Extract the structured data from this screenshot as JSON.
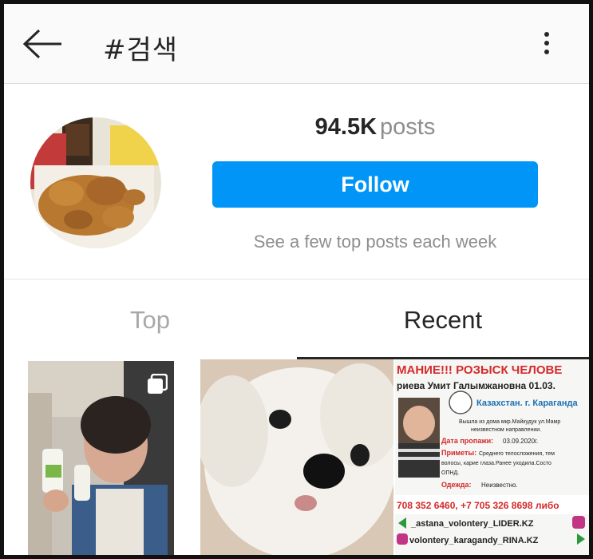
{
  "header": {
    "back_icon": "arrow-left-icon",
    "title": "#검색",
    "more_icon": "vertical-ellipsis-icon"
  },
  "profile": {
    "avatar_icon": "fried-chicken-photo",
    "posts_count": "94.5K",
    "posts_label": "posts",
    "follow_label": "Follow",
    "subtext": "See a few top posts each week",
    "accent_color": "#0095f6"
  },
  "tabs": [
    {
      "label": "Top",
      "active": false
    },
    {
      "label": "Recent",
      "active": true
    }
  ],
  "grid": {
    "items": [
      {
        "icon": "person-with-drinks-photo",
        "multi": true
      },
      {
        "icon": "white-dog-photo",
        "multi": false
      },
      {
        "icon": "missing-person-poster-photo",
        "multi": false
      }
    ],
    "poster": {
      "line1": "МАНИЕ!!! РОЗЫСК ЧЕЛОВЕ",
      "line2": "риева Умит Галымжановна 01.03.",
      "line3": "Казахстан. г. Караганда",
      "line4": "Вышла из дома мкр.Майкудук ул.Мамр",
      "line5": "неизвестном направлении.",
      "line6_label": "Дата пропажи:",
      "line6_value": "03.09.2020г.",
      "line7_label": "Приметы:",
      "line7_value": "Среднего телосложения, тем",
      "line8": "волосы, карие глаза.Ранее уходила.Состо",
      "line9": "ОПНД.",
      "line10_label": "Одежда:",
      "line10_value": "Неизвестно.",
      "phones": "708 352 6460, +7 705 326 8698 либо",
      "handle1": "_astana_volontery_LIDER.KZ",
      "handle2": "volontery_karagandy_RINA.KZ"
    }
  }
}
